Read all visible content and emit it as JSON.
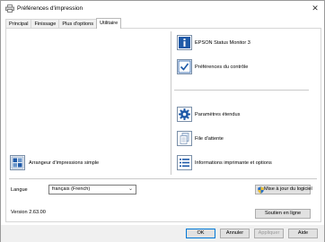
{
  "window": {
    "title": "Préférences d'impression",
    "close_glyph": "✕"
  },
  "tabs": [
    {
      "label": "Principal",
      "active": false
    },
    {
      "label": "Finissage",
      "active": false
    },
    {
      "label": "Plus d'options",
      "active": false
    },
    {
      "label": "Utilitaire",
      "active": true
    }
  ],
  "utilities": {
    "status_monitor": "EPSON Status Monitor 3",
    "control_prefs": "Préférences du contrôle",
    "extended_settings": "Paramètres étendus",
    "print_queue": "File d'attente",
    "printer_info": "Informations imprimante et options",
    "simple_arranger": "Arrangeur d'impressions simple"
  },
  "language": {
    "label": "Langue",
    "selected": "français (French)"
  },
  "buttons": {
    "update_software": "Mise à jour du logiciel",
    "online_support": "Soutien en ligne",
    "ok": "OK",
    "cancel": "Annuler",
    "apply": "Appliquer",
    "help": "Aide"
  },
  "version": "Version 2.63.00",
  "icons": {
    "title": "printer-icon",
    "status_monitor": "info-icon",
    "control_prefs": "checkmark-icon",
    "extended_settings": "gear-icon",
    "print_queue": "document-icon",
    "printer_info": "list-icon",
    "simple_arranger": "arrange-icon",
    "update": "shield-icon"
  },
  "colors": {
    "icon_blue": "#1f5aa8",
    "focus_border": "#0078d7"
  }
}
